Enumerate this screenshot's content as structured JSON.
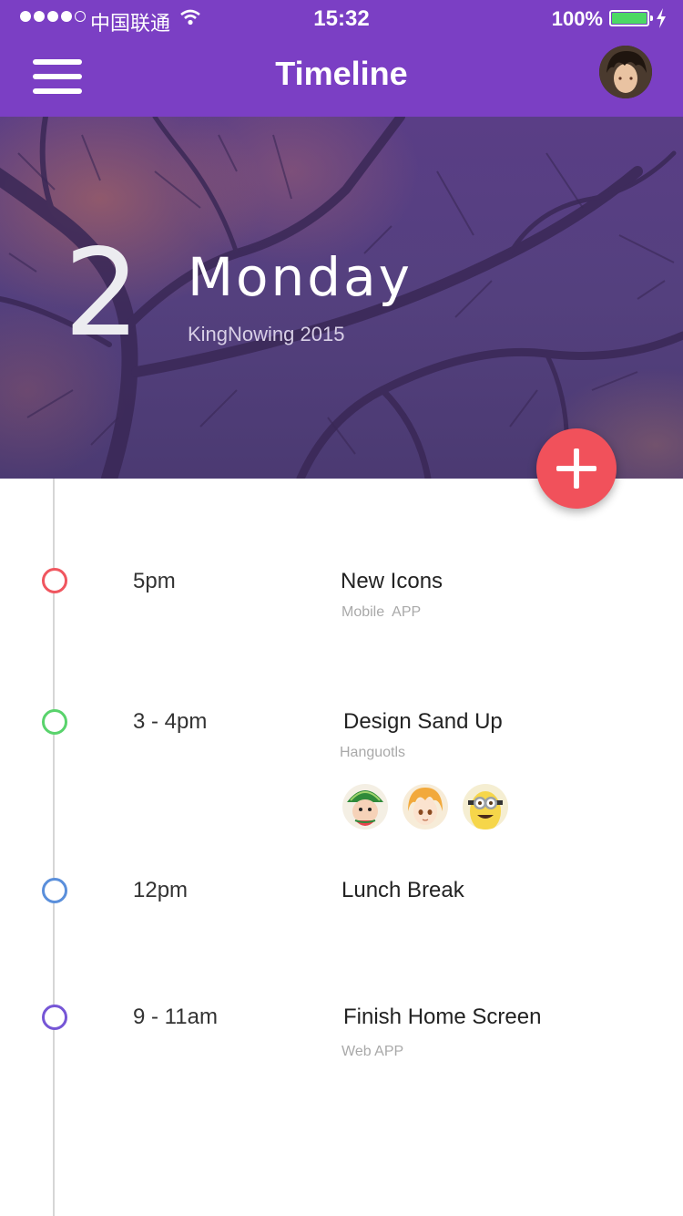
{
  "status_bar": {
    "carrier": "中国联通",
    "time": "15:32",
    "battery_percent": "100%"
  },
  "nav": {
    "title": "Timeline",
    "menu_icon": "hamburger-menu-icon",
    "avatar": "user-avatar"
  },
  "hero": {
    "day_number": "2",
    "day_name": "Monday",
    "subtitle": "KingNowing 2015"
  },
  "fab": {
    "icon": "plus-icon"
  },
  "colors": {
    "primary": "#7b3fc4",
    "accent": "#f1515b",
    "marker_red": "#f0565f",
    "marker_green": "#59d36c",
    "marker_blue": "#5a8fdb",
    "marker_purple": "#7656d6"
  },
  "events": [
    {
      "time": "5pm",
      "title": "New Icons",
      "subtitle": "Mobile  APP",
      "color": "#f0565f"
    },
    {
      "time": "3 - 4pm",
      "title": "Design Sand Up",
      "subtitle": "Hanguotls",
      "color": "#59d36c",
      "participants": [
        "watermelon-kid-avatar",
        "blonde-anime-avatar",
        "minion-avatar"
      ]
    },
    {
      "time": "12pm",
      "title": "Lunch Break",
      "subtitle": "",
      "color": "#5a8fdb"
    },
    {
      "time": "9 - 11am",
      "title": "Finish Home Screen",
      "subtitle": "Web APP",
      "color": "#7656d6"
    }
  ]
}
